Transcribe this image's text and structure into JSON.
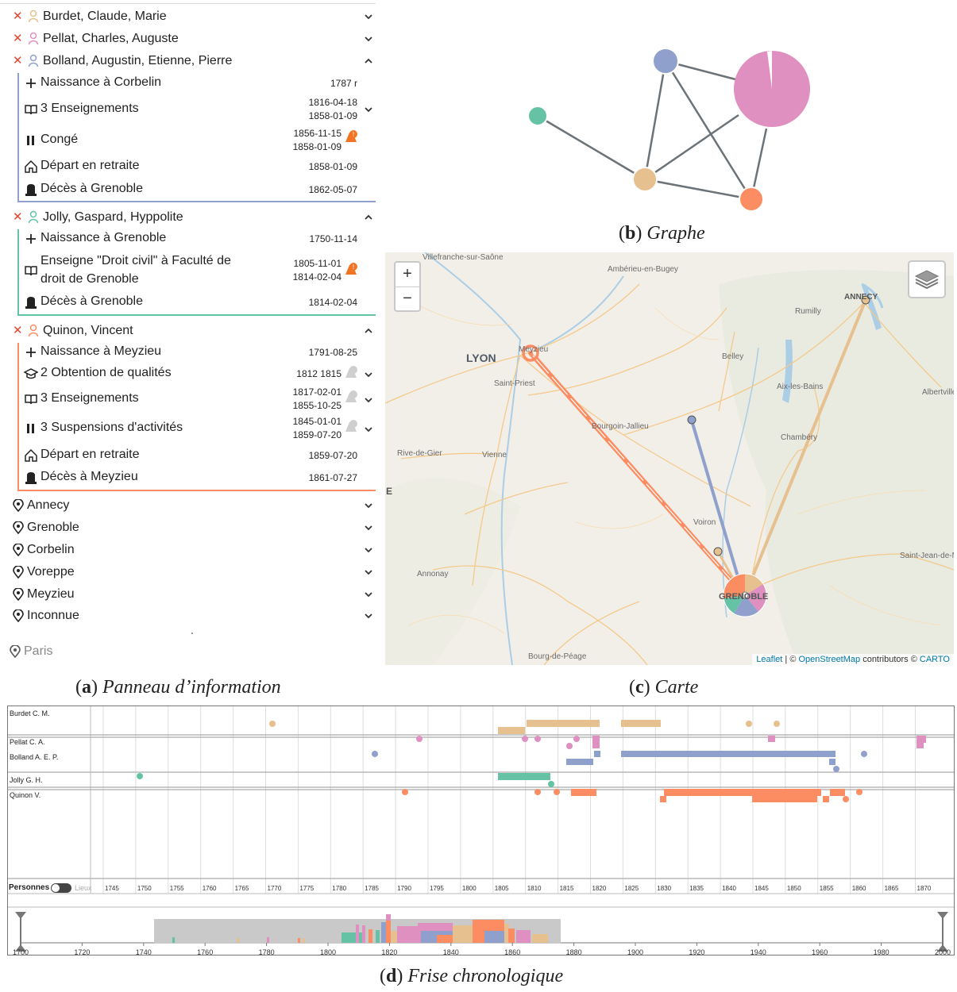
{
  "panel": {
    "persons": [
      {
        "name": "Burdet, Claude, Marie",
        "color": "#e6c08f",
        "expanded": false
      },
      {
        "name": "Pellat, Charles, Auguste",
        "color": "#e090c0",
        "expanded": false
      },
      {
        "name": "Bolland, Augustin, Etienne, Pierre",
        "color": "#8ea0cb",
        "expanded": true,
        "events": [
          {
            "icon": "plus-icon",
            "label": "Naissance à Corbelin",
            "dates": [
              "1787 r"
            ]
          },
          {
            "icon": "book-icon",
            "label": "3 Enseignements",
            "dates": [
              "1816-04-18",
              "1858-01-09"
            ],
            "expandable": true
          },
          {
            "icon": "pause-icon",
            "label": "Congé",
            "dates": [
              "1856-11-15",
              "1858-01-09"
            ],
            "badge": "warning-orange"
          },
          {
            "icon": "home-icon",
            "label": "Départ en retraite",
            "dates": [
              "1858-01-09"
            ]
          },
          {
            "icon": "tombstone-icon",
            "label": "Décès à Grenoble",
            "dates": [
              "1862-05-07"
            ]
          }
        ]
      },
      {
        "name": "Jolly, Gaspard, Hyppolite",
        "color": "#66c2a5",
        "expanded": true,
        "events": [
          {
            "icon": "plus-icon",
            "label": "Naissance à Grenoble",
            "dates": [
              "1750-11-14"
            ]
          },
          {
            "icon": "book-icon",
            "label_lines": [
              "Enseigne \"Droit civil\" à Faculté de",
              "droit de Grenoble"
            ],
            "dates": [
              "1805-11-01",
              "1814-02-04"
            ],
            "badge": "warning-orange"
          },
          {
            "icon": "tombstone-icon",
            "label": "Décès à Grenoble",
            "dates": [
              "1814-02-04"
            ]
          }
        ]
      },
      {
        "name": "Quinon, Vincent",
        "color": "#fc8d62",
        "expanded": true,
        "events": [
          {
            "icon": "plus-icon",
            "label": "Naissance à Meyzieu",
            "dates": [
              "1791-08-25"
            ]
          },
          {
            "icon": "graduation-cap-icon",
            "label": "2 Obtention de qualités",
            "dates": [
              "1812  1815"
            ],
            "badge": "warning-grey",
            "expandable": true
          },
          {
            "icon": "book-icon",
            "label": "3 Enseignements",
            "dates": [
              "1817-02-01",
              "1855-10-25"
            ],
            "badge": "warning-grey",
            "expandable": true
          },
          {
            "icon": "pause-icon",
            "label": "3 Suspensions d'activités",
            "dates": [
              "1845-01-01",
              "1859-07-20"
            ],
            "badge": "warning-grey",
            "expandable": true
          },
          {
            "icon": "home-icon",
            "label": "Départ en retraite",
            "dates": [
              "1859-07-20"
            ]
          },
          {
            "icon": "tombstone-icon",
            "label": "Décès à Meyzieu",
            "dates": [
              "1861-07-27"
            ]
          }
        ]
      }
    ],
    "places": [
      "Annecy",
      "Grenoble",
      "Corbelin",
      "Voreppe",
      "Meyzieu",
      "Inconnue"
    ],
    "extra_place": "Paris"
  },
  "captions": {
    "a": {
      "letter": "a",
      "text": "Panneau d’information"
    },
    "b": {
      "letter": "b",
      "text": "Graphe"
    },
    "c": {
      "letter": "c",
      "text": "Carte"
    },
    "d": {
      "letter": "d",
      "text": "Frise chronologique"
    }
  },
  "graph": {
    "nodes": [
      {
        "id": "bolland",
        "color": "#8ea0cb"
      },
      {
        "id": "pellat",
        "color": "#e090c0"
      },
      {
        "id": "jolly",
        "color": "#66c2a5"
      },
      {
        "id": "burdet",
        "color": "#e6c08f"
      },
      {
        "id": "quinon",
        "color": "#fc8d62"
      }
    ],
    "edges": [
      [
        "bolland",
        "pellat"
      ],
      [
        "bolland",
        "burdet"
      ],
      [
        "bolland",
        "quinon"
      ],
      [
        "pellat",
        "burdet"
      ],
      [
        "pellat",
        "quinon"
      ],
      [
        "jolly",
        "burdet"
      ],
      [
        "burdet",
        "quinon"
      ]
    ],
    "edge_color": "#6b7378"
  },
  "map": {
    "zoom_in": "+",
    "zoom_out": "−",
    "cities": [
      "LYON"
    ],
    "places": [
      "Villefranche-sur-Saône",
      "Ambérieu-en-Bugey",
      "ANNECY",
      "Rumilly",
      "Belley",
      "Aix-les-Bains",
      "Albertville",
      "Saint-Priest",
      "Bourgoin-Jallieu",
      "Chambéry",
      "Rive-de-Gier",
      "Vienne",
      "Voiron",
      "Saint-Jean-de-Maurienne",
      "Annonay",
      "GRENOBLE",
      "Bourg-de-Péage",
      "E",
      "Meyzieu"
    ],
    "attribution": {
      "leaflet": "Leaflet",
      "sep1": " | © ",
      "osm": "OpenStreetMap",
      "contrib": " contributors © ",
      "carto": "CARTO"
    }
  },
  "timeline": {
    "rows": [
      "Burdet C. M.",
      "Pellat C. A.",
      "Bolland A. E. P.",
      "Jolly G. H.",
      "Quinon V."
    ],
    "toggle_left": "Personnes",
    "toggle_right": "Lieux",
    "upper_ticks": [
      "1745",
      "1750",
      "1755",
      "1760",
      "1765",
      "1770",
      "1775",
      "1780",
      "1785",
      "1790",
      "1795",
      "1800",
      "1805",
      "1810",
      "1815",
      "1820",
      "1825",
      "1830",
      "1835",
      "1840",
      "1845",
      "1850",
      "1855",
      "1860",
      "1865",
      "1870"
    ],
    "lower_ticks": [
      "1700",
      "1720",
      "1740",
      "1760",
      "1780",
      "1800",
      "1820",
      "1840",
      "1860",
      "1880",
      "1900",
      "1920",
      "1940",
      "1960",
      "1980",
      "2000"
    ]
  }
}
